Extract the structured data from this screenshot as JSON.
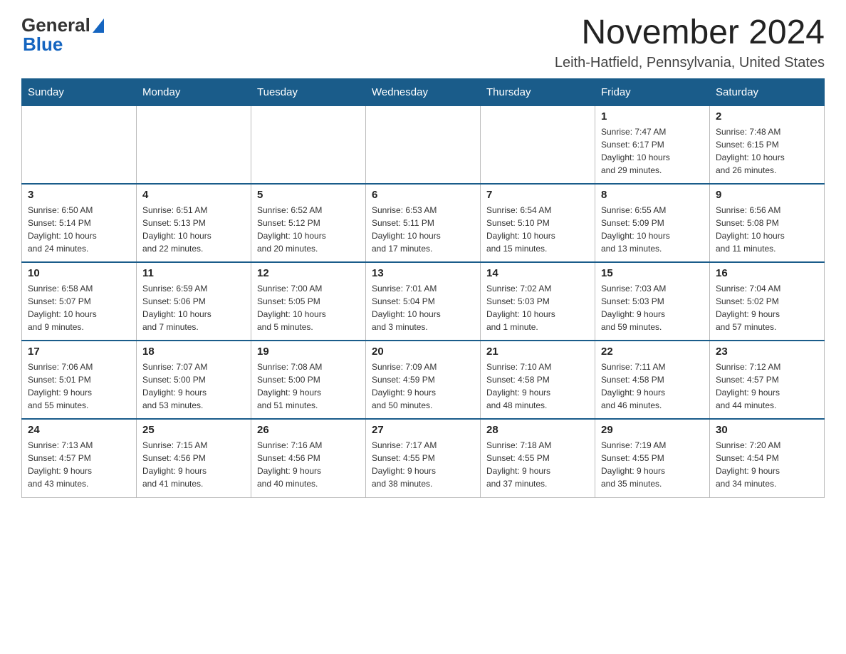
{
  "header": {
    "logo": {
      "text_general": "General",
      "text_blue": "Blue",
      "aria": "GeneralBlue logo"
    },
    "title": "November 2024",
    "location": "Leith-Hatfield, Pennsylvania, United States"
  },
  "calendar": {
    "days_of_week": [
      "Sunday",
      "Monday",
      "Tuesday",
      "Wednesday",
      "Thursday",
      "Friday",
      "Saturday"
    ],
    "weeks": [
      [
        {
          "day": "",
          "info": ""
        },
        {
          "day": "",
          "info": ""
        },
        {
          "day": "",
          "info": ""
        },
        {
          "day": "",
          "info": ""
        },
        {
          "day": "",
          "info": ""
        },
        {
          "day": "1",
          "info": "Sunrise: 7:47 AM\nSunset: 6:17 PM\nDaylight: 10 hours\nand 29 minutes."
        },
        {
          "day": "2",
          "info": "Sunrise: 7:48 AM\nSunset: 6:15 PM\nDaylight: 10 hours\nand 26 minutes."
        }
      ],
      [
        {
          "day": "3",
          "info": "Sunrise: 6:50 AM\nSunset: 5:14 PM\nDaylight: 10 hours\nand 24 minutes."
        },
        {
          "day": "4",
          "info": "Sunrise: 6:51 AM\nSunset: 5:13 PM\nDaylight: 10 hours\nand 22 minutes."
        },
        {
          "day": "5",
          "info": "Sunrise: 6:52 AM\nSunset: 5:12 PM\nDaylight: 10 hours\nand 20 minutes."
        },
        {
          "day": "6",
          "info": "Sunrise: 6:53 AM\nSunset: 5:11 PM\nDaylight: 10 hours\nand 17 minutes."
        },
        {
          "day": "7",
          "info": "Sunrise: 6:54 AM\nSunset: 5:10 PM\nDaylight: 10 hours\nand 15 minutes."
        },
        {
          "day": "8",
          "info": "Sunrise: 6:55 AM\nSunset: 5:09 PM\nDaylight: 10 hours\nand 13 minutes."
        },
        {
          "day": "9",
          "info": "Sunrise: 6:56 AM\nSunset: 5:08 PM\nDaylight: 10 hours\nand 11 minutes."
        }
      ],
      [
        {
          "day": "10",
          "info": "Sunrise: 6:58 AM\nSunset: 5:07 PM\nDaylight: 10 hours\nand 9 minutes."
        },
        {
          "day": "11",
          "info": "Sunrise: 6:59 AM\nSunset: 5:06 PM\nDaylight: 10 hours\nand 7 minutes."
        },
        {
          "day": "12",
          "info": "Sunrise: 7:00 AM\nSunset: 5:05 PM\nDaylight: 10 hours\nand 5 minutes."
        },
        {
          "day": "13",
          "info": "Sunrise: 7:01 AM\nSunset: 5:04 PM\nDaylight: 10 hours\nand 3 minutes."
        },
        {
          "day": "14",
          "info": "Sunrise: 7:02 AM\nSunset: 5:03 PM\nDaylight: 10 hours\nand 1 minute."
        },
        {
          "day": "15",
          "info": "Sunrise: 7:03 AM\nSunset: 5:03 PM\nDaylight: 9 hours\nand 59 minutes."
        },
        {
          "day": "16",
          "info": "Sunrise: 7:04 AM\nSunset: 5:02 PM\nDaylight: 9 hours\nand 57 minutes."
        }
      ],
      [
        {
          "day": "17",
          "info": "Sunrise: 7:06 AM\nSunset: 5:01 PM\nDaylight: 9 hours\nand 55 minutes."
        },
        {
          "day": "18",
          "info": "Sunrise: 7:07 AM\nSunset: 5:00 PM\nDaylight: 9 hours\nand 53 minutes."
        },
        {
          "day": "19",
          "info": "Sunrise: 7:08 AM\nSunset: 5:00 PM\nDaylight: 9 hours\nand 51 minutes."
        },
        {
          "day": "20",
          "info": "Sunrise: 7:09 AM\nSunset: 4:59 PM\nDaylight: 9 hours\nand 50 minutes."
        },
        {
          "day": "21",
          "info": "Sunrise: 7:10 AM\nSunset: 4:58 PM\nDaylight: 9 hours\nand 48 minutes."
        },
        {
          "day": "22",
          "info": "Sunrise: 7:11 AM\nSunset: 4:58 PM\nDaylight: 9 hours\nand 46 minutes."
        },
        {
          "day": "23",
          "info": "Sunrise: 7:12 AM\nSunset: 4:57 PM\nDaylight: 9 hours\nand 44 minutes."
        }
      ],
      [
        {
          "day": "24",
          "info": "Sunrise: 7:13 AM\nSunset: 4:57 PM\nDaylight: 9 hours\nand 43 minutes."
        },
        {
          "day": "25",
          "info": "Sunrise: 7:15 AM\nSunset: 4:56 PM\nDaylight: 9 hours\nand 41 minutes."
        },
        {
          "day": "26",
          "info": "Sunrise: 7:16 AM\nSunset: 4:56 PM\nDaylight: 9 hours\nand 40 minutes."
        },
        {
          "day": "27",
          "info": "Sunrise: 7:17 AM\nSunset: 4:55 PM\nDaylight: 9 hours\nand 38 minutes."
        },
        {
          "day": "28",
          "info": "Sunrise: 7:18 AM\nSunset: 4:55 PM\nDaylight: 9 hours\nand 37 minutes."
        },
        {
          "day": "29",
          "info": "Sunrise: 7:19 AM\nSunset: 4:55 PM\nDaylight: 9 hours\nand 35 minutes."
        },
        {
          "day": "30",
          "info": "Sunrise: 7:20 AM\nSunset: 4:54 PM\nDaylight: 9 hours\nand 34 minutes."
        }
      ]
    ]
  }
}
